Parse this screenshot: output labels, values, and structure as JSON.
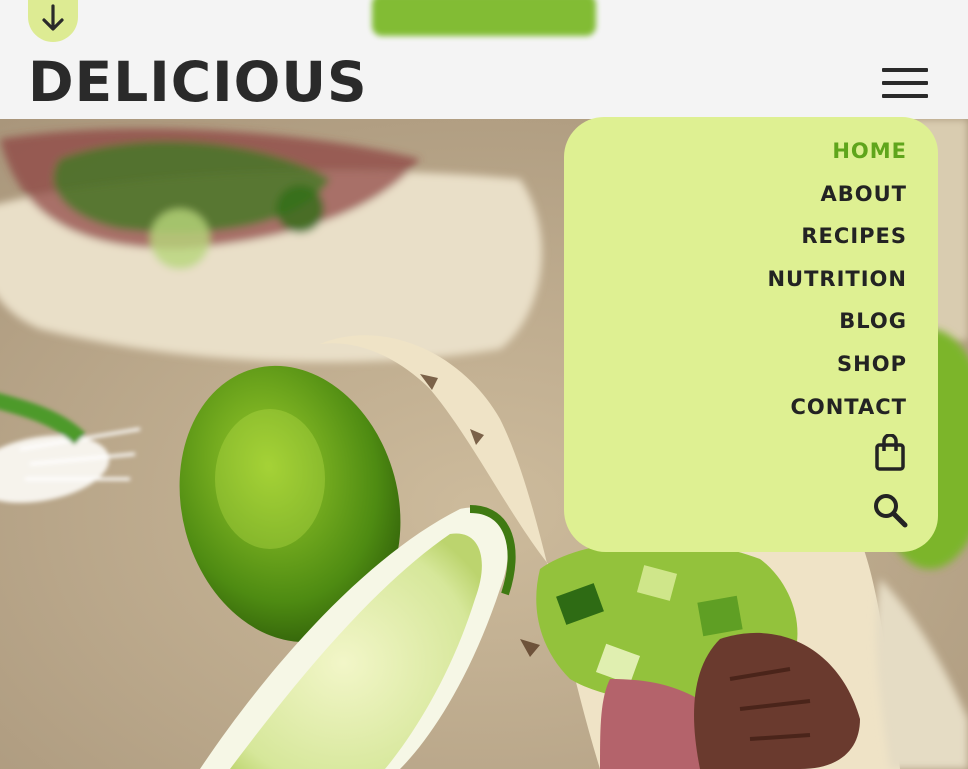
{
  "header": {
    "scroll_down_icon": "arrow-down-icon",
    "logo_text": "DELICIOUS",
    "menu_icon": "hamburger-menu-icon"
  },
  "nav": {
    "items": [
      {
        "label": "HOME",
        "active": true
      },
      {
        "label": "ABOUT",
        "active": false
      },
      {
        "label": "RECIPES",
        "active": false
      },
      {
        "label": "NUTRITION",
        "active": false
      },
      {
        "label": "BLOG",
        "active": false
      },
      {
        "label": "SHOP",
        "active": false
      },
      {
        "label": "CONTACT",
        "active": false
      }
    ],
    "cart_icon": "shopping-bag-icon",
    "search_icon": "search-icon"
  },
  "hero": {
    "image_subject": "tacos-with-limes-photo"
  },
  "colors": {
    "accent": "#7cba2a",
    "menu_bg": "#def092",
    "active_link": "#5fa51b",
    "text": "#232323",
    "header_bg": "#f4f4f4"
  }
}
